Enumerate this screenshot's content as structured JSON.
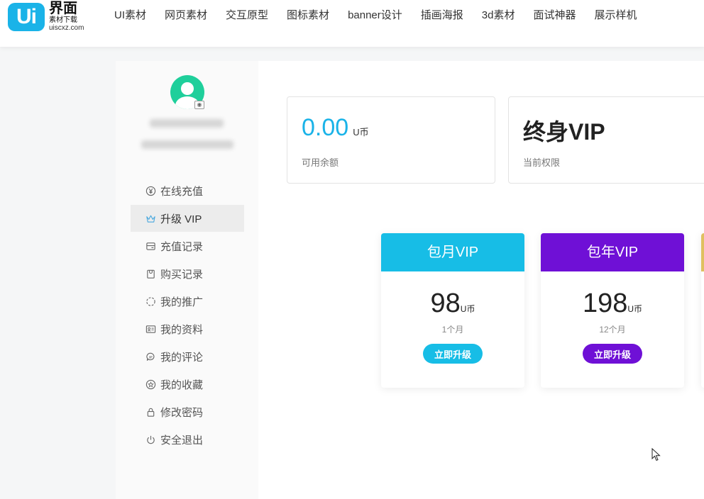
{
  "logo": {
    "badge": "Ui",
    "name": "界面",
    "tagline": "素材下载",
    "url": "uiscxz.com"
  },
  "nav": [
    {
      "label": "UI素材"
    },
    {
      "label": "网页素材"
    },
    {
      "label": "交互原型"
    },
    {
      "label": "图标素材"
    },
    {
      "label": "banner设计"
    },
    {
      "label": "插画海报"
    },
    {
      "label": "3d素材"
    },
    {
      "label": "面试神器"
    },
    {
      "label": "展示样机"
    }
  ],
  "sidebar": {
    "menu": [
      {
        "label": "在线充值",
        "icon": "yen-circle-icon"
      },
      {
        "label": "升级 VIP",
        "icon": "crown-icon",
        "active": true
      },
      {
        "label": "充值记录",
        "icon": "wallet-icon"
      },
      {
        "label": "购买记录",
        "icon": "bag-icon"
      },
      {
        "label": "我的推广",
        "icon": "spread-icon"
      },
      {
        "label": "我的资料",
        "icon": "id-card-icon"
      },
      {
        "label": "我的评论",
        "icon": "comment-icon"
      },
      {
        "label": "我的收藏",
        "icon": "star-circle-icon"
      },
      {
        "label": "修改密码",
        "icon": "lock-icon"
      },
      {
        "label": "安全退出",
        "icon": "power-icon"
      }
    ]
  },
  "stats": {
    "balance": {
      "value": "0.00",
      "unit": "U币",
      "label": "可用余额"
    },
    "level": {
      "value": "终身VIP",
      "label": "当前权限"
    }
  },
  "plans": [
    {
      "name": "包月VIP",
      "price": "98",
      "unit": "U币",
      "duration": "1个月",
      "button": "立即升级",
      "color": "#17bde6"
    },
    {
      "name": "包年VIP",
      "price": "198",
      "unit": "U币",
      "duration": "12个月",
      "button": "立即升级",
      "color": "#6f10d6"
    },
    {
      "color": "#e0c060"
    }
  ],
  "colors": {
    "accent": "#1ab3e8",
    "monthly": "#17bde6",
    "yearly": "#6f10d6"
  }
}
